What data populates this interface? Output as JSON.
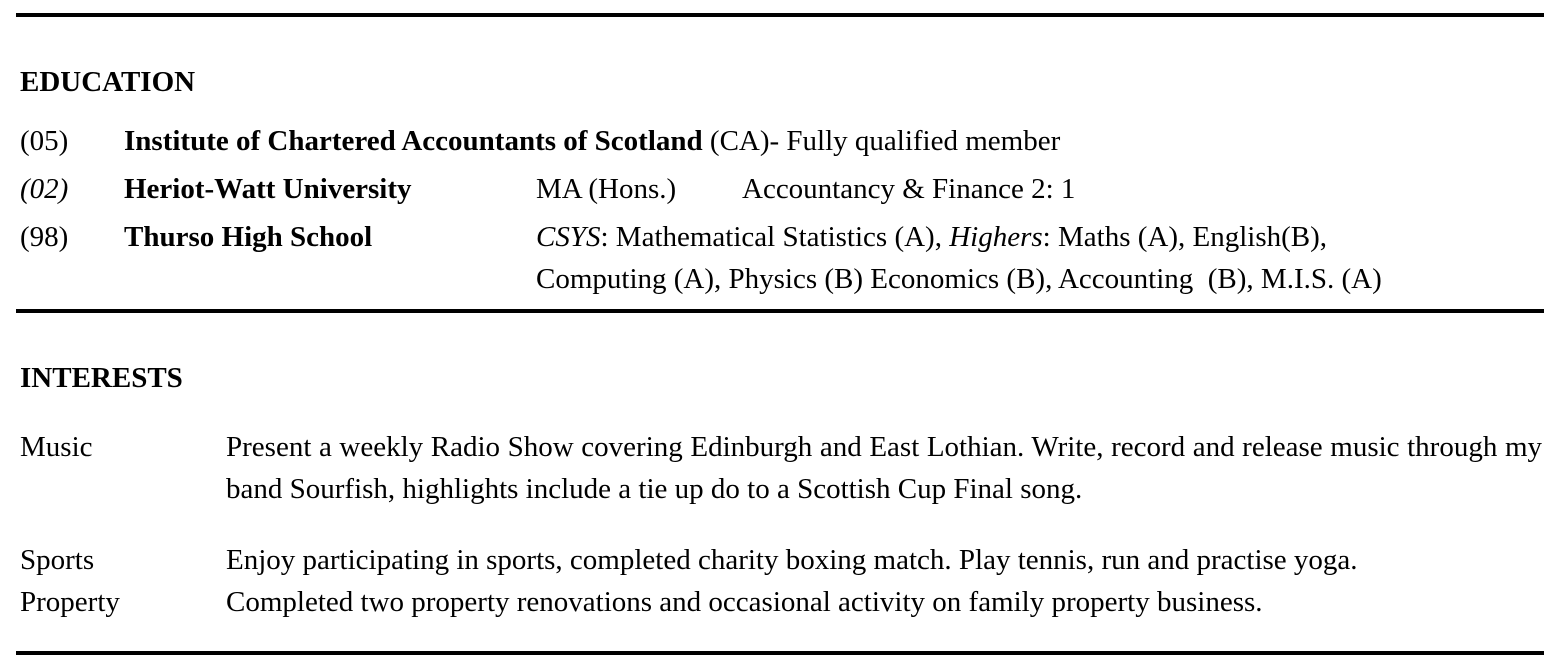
{
  "education": {
    "heading": "EDUCATION",
    "entries": [
      {
        "year": "(05)",
        "institution": "Institute of Chartered Accountants of Scotland",
        "details": " (CA)- Fully qualified member"
      },
      {
        "year": "(02)",
        "institution": "Heriot-Watt University",
        "degree": "MA (Hons.)",
        "subject": "Accountancy & Finance 2: 1"
      },
      {
        "year": "(98)",
        "institution": "Thurso High School",
        "csys_label": "CSYS",
        "csys_text": ": Mathematical Statistics (A), ",
        "highers_label": "Highers",
        "highers_text": ": Maths (A), English(B),",
        "line2": "Computing (A), Physics (B) Economics (B), Accounting  (B), M.I.S. (A)"
      }
    ]
  },
  "interests": {
    "heading": "INTERESTS",
    "items": [
      {
        "label": "Music",
        "text": "Present a weekly Radio Show covering Edinburgh and East Lothian. Write, record and release music through my band Sourfish, highlights include a tie up do to a Scottish Cup Final song."
      },
      {
        "label": "Sports",
        "text": "Enjoy participating in sports, completed charity boxing match. Play tennis, run and practise yoga."
      },
      {
        "label": "Property",
        "text": "Completed two property renovations and occasional activity on family property business."
      }
    ]
  }
}
